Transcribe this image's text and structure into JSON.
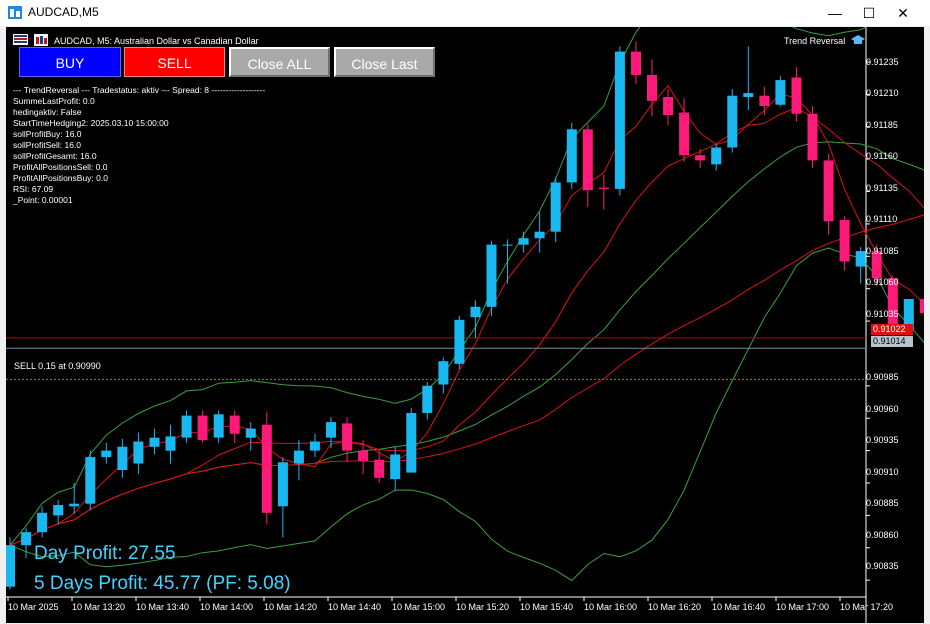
{
  "window": {
    "title": "AUDCAD,M5"
  },
  "chart_header": {
    "symbol_text": "AUDCAD, M5:  Australian Dollar vs Canadian Dollar",
    "ea_name": "Trend Reversal"
  },
  "buttons": {
    "buy": "BUY",
    "sell": "SELL",
    "close_all": "Close ALL",
    "close_last": "Close Last"
  },
  "status_lines": [
    "--- TrendReversal --- Tradestatus: aktiv --- Spread: 8 -------------------",
    "SummeLastProfit: 0.0",
    "hedingaktiv: False",
    "StartTimeHedging2: 2025.03.10 15:00:00",
    "sollProfitBuy: 16.0",
    "sollProfitSell: 16.0",
    "sollProfitGesamt: 16.0",
    "ProfitAllPositionsSell: 0.0",
    "ProfitAllPositionsBuy: 0.0",
    "RSI: 67.09",
    "_Point: 0.00001"
  ],
  "order_line_label": "SELL 0.15 at 0.90990",
  "profit": {
    "day": "Day Profit: 27.55",
    "five_days": "5 Days Profit: 45.77 (PF: 5.08)"
  },
  "price_axis": [
    "0.91235",
    "0.91210",
    "0.91185",
    "0.91160",
    "0.91135",
    "0.91110",
    "0.91085",
    "0.91060",
    "0.91035",
    "0.90985",
    "0.90960",
    "0.90935",
    "0.90910",
    "0.90885",
    "0.90860",
    "0.90835"
  ],
  "price_tags": {
    "ask": "0.91022",
    "bid": "0.91014"
  },
  "time_axis": [
    "10 Mar 2025",
    "10 Mar 13:20",
    "10 Mar 13:40",
    "10 Mar 14:00",
    "10 Mar 14:20",
    "10 Mar 14:40",
    "10 Mar 15:00",
    "10 Mar 15:20",
    "10 Mar 15:40",
    "10 Mar 16:00",
    "10 Mar 16:20",
    "10 Mar 16:40",
    "10 Mar 17:00",
    "10 Mar 17:20"
  ],
  "colors": {
    "bull": "#1ab8f0",
    "bear": "#ff1a7a",
    "ma_red": "#e01010",
    "bands": "#3aa040",
    "bg": "#000000",
    "ask_line": "#c00000",
    "bid_line": "#7a8a9a"
  },
  "chart_data": {
    "type": "candlestick",
    "symbol": "AUDCAD",
    "timeframe": "M5",
    "ylim": [
      0.90822,
      0.91262
    ],
    "candles": [
      {
        "o": 0.9083,
        "h": 0.90868,
        "l": 0.90828,
        "c": 0.90862
      },
      {
        "o": 0.90862,
        "h": 0.90875,
        "l": 0.90852,
        "c": 0.90872
      },
      {
        "o": 0.90872,
        "h": 0.90892,
        "l": 0.90868,
        "c": 0.90887
      },
      {
        "o": 0.90885,
        "h": 0.90897,
        "l": 0.90878,
        "c": 0.90893
      },
      {
        "o": 0.90892,
        "h": 0.9091,
        "l": 0.90886,
        "c": 0.90894
      },
      {
        "o": 0.90894,
        "h": 0.90935,
        "l": 0.90889,
        "c": 0.9093
      },
      {
        "o": 0.9093,
        "h": 0.90941,
        "l": 0.90925,
        "c": 0.90935
      },
      {
        "o": 0.9092,
        "h": 0.90944,
        "l": 0.90914,
        "c": 0.90938
      },
      {
        "o": 0.90925,
        "h": 0.90949,
        "l": 0.90917,
        "c": 0.90942
      },
      {
        "o": 0.90938,
        "h": 0.90952,
        "l": 0.90932,
        "c": 0.90945
      },
      {
        "o": 0.90935,
        "h": 0.90955,
        "l": 0.90925,
        "c": 0.90946
      },
      {
        "o": 0.90945,
        "h": 0.90966,
        "l": 0.90941,
        "c": 0.90962
      },
      {
        "o": 0.90962,
        "h": 0.90966,
        "l": 0.90941,
        "c": 0.90943
      },
      {
        "o": 0.90945,
        "h": 0.90966,
        "l": 0.90941,
        "c": 0.90963
      },
      {
        "o": 0.90962,
        "h": 0.90966,
        "l": 0.90941,
        "c": 0.90948
      },
      {
        "o": 0.90945,
        "h": 0.90957,
        "l": 0.90935,
        "c": 0.90952
      },
      {
        "o": 0.90955,
        "h": 0.90965,
        "l": 0.90878,
        "c": 0.90887
      },
      {
        "o": 0.90892,
        "h": 0.9093,
        "l": 0.90868,
        "c": 0.90926
      },
      {
        "o": 0.90925,
        "h": 0.90943,
        "l": 0.90912,
        "c": 0.90935
      },
      {
        "o": 0.90935,
        "h": 0.90948,
        "l": 0.9093,
        "c": 0.90942
      },
      {
        "o": 0.90945,
        "h": 0.90961,
        "l": 0.90937,
        "c": 0.90957
      },
      {
        "o": 0.90956,
        "h": 0.90961,
        "l": 0.90926,
        "c": 0.90935
      },
      {
        "o": 0.90935,
        "h": 0.90943,
        "l": 0.90917,
        "c": 0.90927
      },
      {
        "o": 0.90928,
        "h": 0.90936,
        "l": 0.9091,
        "c": 0.90914
      },
      {
        "o": 0.90913,
        "h": 0.90938,
        "l": 0.90904,
        "c": 0.90932
      },
      {
        "o": 0.90918,
        "h": 0.90968,
        "l": 0.90918,
        "c": 0.90964
      },
      {
        "o": 0.90964,
        "h": 0.90988,
        "l": 0.90959,
        "c": 0.90985
      },
      {
        "o": 0.90986,
        "h": 0.91007,
        "l": 0.90979,
        "c": 0.91004
      },
      {
        "o": 0.91002,
        "h": 0.91039,
        "l": 0.90998,
        "c": 0.91036
      },
      {
        "o": 0.91038,
        "h": 0.91051,
        "l": 0.91022,
        "c": 0.91046
      },
      {
        "o": 0.91046,
        "h": 0.91097,
        "l": 0.91039,
        "c": 0.91094
      },
      {
        "o": 0.91094,
        "h": 0.91098,
        "l": 0.91064,
        "c": 0.91094
      },
      {
        "o": 0.91094,
        "h": 0.91104,
        "l": 0.91088,
        "c": 0.91099
      },
      {
        "o": 0.91099,
        "h": 0.91119,
        "l": 0.91088,
        "c": 0.91104
      },
      {
        "o": 0.91104,
        "h": 0.91146,
        "l": 0.91096,
        "c": 0.91142
      },
      {
        "o": 0.91142,
        "h": 0.91188,
        "l": 0.91137,
        "c": 0.91183
      },
      {
        "o": 0.91183,
        "h": 0.91187,
        "l": 0.91123,
        "c": 0.91136
      },
      {
        "o": 0.91138,
        "h": 0.91148,
        "l": 0.91121,
        "c": 0.91137
      },
      {
        "o": 0.91137,
        "h": 0.91247,
        "l": 0.91132,
        "c": 0.91243
      },
      {
        "o": 0.91243,
        "h": 0.91251,
        "l": 0.91218,
        "c": 0.91225
      },
      {
        "o": 0.91225,
        "h": 0.91237,
        "l": 0.91193,
        "c": 0.91205
      },
      {
        "o": 0.91208,
        "h": 0.91214,
        "l": 0.91186,
        "c": 0.91194
      },
      {
        "o": 0.91196,
        "h": 0.91207,
        "l": 0.91158,
        "c": 0.91163
      },
      {
        "o": 0.91163,
        "h": 0.91168,
        "l": 0.91153,
        "c": 0.91159
      },
      {
        "o": 0.91156,
        "h": 0.91172,
        "l": 0.91151,
        "c": 0.91169
      },
      {
        "o": 0.91169,
        "h": 0.91214,
        "l": 0.91165,
        "c": 0.91209
      },
      {
        "o": 0.91208,
        "h": 0.91247,
        "l": 0.91198,
        "c": 0.91211
      },
      {
        "o": 0.91209,
        "h": 0.91216,
        "l": 0.91194,
        "c": 0.91201
      },
      {
        "o": 0.91202,
        "h": 0.91224,
        "l": 0.91201,
        "c": 0.91221
      },
      {
        "o": 0.91223,
        "h": 0.91231,
        "l": 0.91189,
        "c": 0.91195
      },
      {
        "o": 0.91195,
        "h": 0.91201,
        "l": 0.91153,
        "c": 0.91159
      },
      {
        "o": 0.91159,
        "h": 0.91164,
        "l": 0.91102,
        "c": 0.91112
      },
      {
        "o": 0.91113,
        "h": 0.91116,
        "l": 0.91074,
        "c": 0.91081
      },
      {
        "o": 0.91077,
        "h": 0.91092,
        "l": 0.91064,
        "c": 0.91089
      },
      {
        "o": 0.91089,
        "h": 0.91094,
        "l": 0.91062,
        "c": 0.91068
      },
      {
        "o": 0.91068,
        "h": 0.9107,
        "l": 0.91023,
        "c": 0.9103
      },
      {
        "o": 0.91028,
        "h": 0.9105,
        "l": 0.91024,
        "c": 0.91052
      },
      {
        "o": 0.91052,
        "h": 0.91088,
        "l": 0.9104,
        "c": 0.91041
      },
      {
        "o": 0.91041,
        "h": 0.91052,
        "l": 0.90996,
        "c": 0.91005
      },
      {
        "o": 0.91014,
        "h": 0.91022,
        "l": 0.9097,
        "c": 0.91014
      }
    ]
  }
}
